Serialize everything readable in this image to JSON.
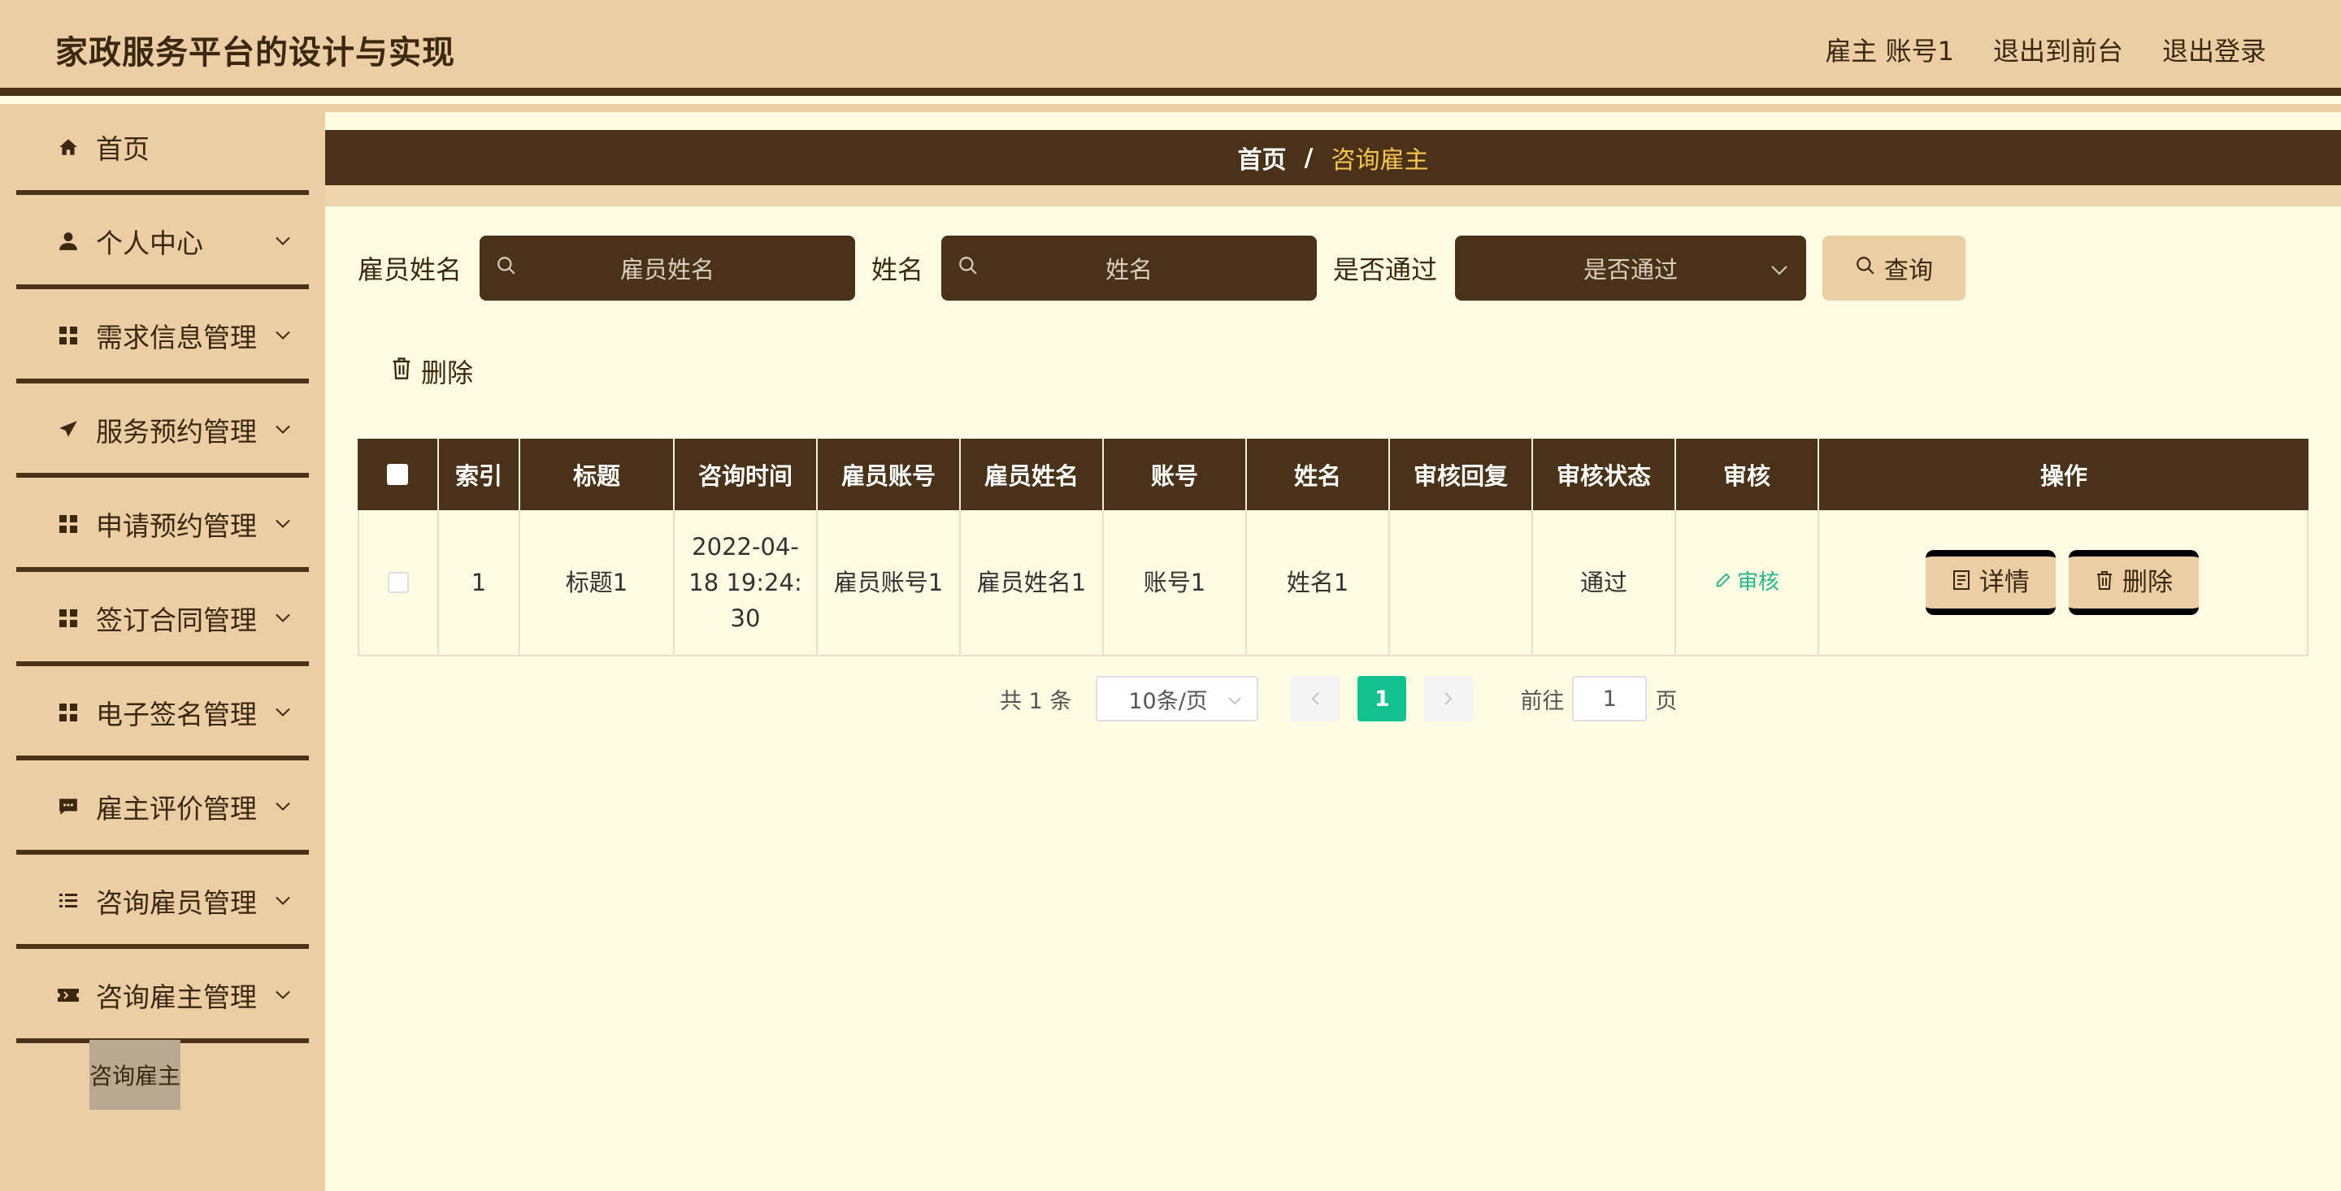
{
  "header": {
    "title": "家政服务平台的设计与实现",
    "user_label": "雇主 账号1",
    "exit_front": "退出到前台",
    "logout": "退出登录"
  },
  "sidebar": {
    "items": [
      {
        "label": "首页",
        "icon": "home-icon"
      },
      {
        "label": "个人中心",
        "icon": "user-icon"
      },
      {
        "label": "需求信息管理",
        "icon": "grid-icon"
      },
      {
        "label": "服务预约管理",
        "icon": "send-icon"
      },
      {
        "label": "申请预约管理",
        "icon": "grid-icon"
      },
      {
        "label": "签订合同管理",
        "icon": "grid-icon"
      },
      {
        "label": "电子签名管理",
        "icon": "grid-icon"
      },
      {
        "label": "雇主评价管理",
        "icon": "chat-icon"
      },
      {
        "label": "咨询雇员管理",
        "icon": "list-icon"
      },
      {
        "label": "咨询雇主管理",
        "icon": "ticket-icon"
      }
    ],
    "submenu_active": "咨询雇主"
  },
  "breadcrumb": {
    "home": "首页",
    "separator": "/",
    "current": "咨询雇主"
  },
  "search": {
    "employee_name_label": "雇员姓名",
    "employee_name_placeholder": "雇员姓名",
    "name_label": "姓名",
    "name_placeholder": "姓名",
    "passed_label": "是否通过",
    "passed_placeholder": "是否通过",
    "query_button": "查询"
  },
  "toolbar": {
    "delete_label": "删除"
  },
  "table": {
    "headers": [
      "",
      "索引",
      "标题",
      "咨询时间",
      "雇员账号",
      "雇员姓名",
      "账号",
      "姓名",
      "审核回复",
      "审核状态",
      "审核",
      "操作"
    ],
    "rows": [
      {
        "index": "1",
        "title": "标题1",
        "time_line1": "2022-04-",
        "time_line2": "18 19:24:",
        "time_line3": "30",
        "employee_account": "雇员账号1",
        "employee_name": "雇员姓名1",
        "account": "账号1",
        "name": "姓名1",
        "reply": "",
        "status": "通过",
        "audit_link": "审核",
        "detail_button": "详情",
        "delete_button": "删除"
      }
    ]
  },
  "pagination": {
    "total": "共 1 条",
    "page_size": "10条/页",
    "current_page": "1",
    "goto_label": "前往",
    "goto_value": "1",
    "page_suffix": "页"
  },
  "colors": {
    "header_bg": "#ecceA4",
    "dark_brown": "#4a3218",
    "main_bg": "#fefbe2",
    "accent_green": "#13c08f",
    "breadcrumb_current": "#f5c453"
  }
}
